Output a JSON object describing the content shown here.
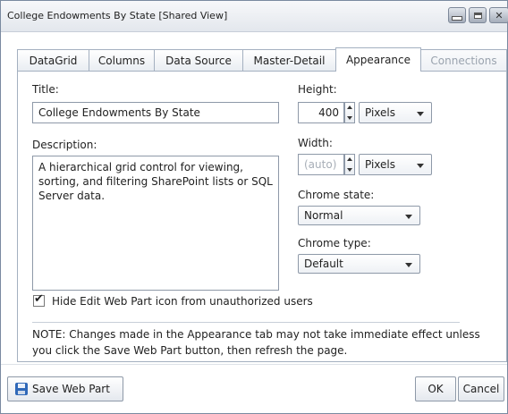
{
  "window": {
    "title": "College Endowments By State [Shared View]"
  },
  "tabs": [
    {
      "label": "DataGrid",
      "state": "normal"
    },
    {
      "label": "Columns",
      "state": "normal"
    },
    {
      "label": "Data Source",
      "state": "normal"
    },
    {
      "label": "Master-Detail",
      "state": "normal"
    },
    {
      "label": "Appearance",
      "state": "active"
    },
    {
      "label": "Connections",
      "state": "disabled"
    }
  ],
  "form": {
    "title_label": "Title:",
    "title_value": "College Endowments By State",
    "description_label": "Description:",
    "description_value": "A hierarchical grid control for viewing, sorting, and filtering SharePoint lists or SQL Server data.",
    "height_label": "Height:",
    "height_value": "400",
    "height_unit": "Pixels",
    "width_label": "Width:",
    "width_value": "(auto)",
    "width_unit": "Pixels",
    "chrome_state_label": "Chrome state:",
    "chrome_state_value": "Normal",
    "chrome_type_label": "Chrome type:",
    "chrome_type_value": "Default",
    "hide_icon_label": "Hide Edit Web Part icon from unauthorized users",
    "hide_icon_checked": true,
    "note": "NOTE: Changes made in the Appearance tab may not take immediate effect unless you click the Save Web Part button, then refresh the page."
  },
  "footer": {
    "save_label": "Save Web Part",
    "ok_label": "OK",
    "cancel_label": "Cancel"
  },
  "icons": {
    "minimize": "minimize-icon",
    "maximize": "maximize-icon",
    "close": "close-icon",
    "save": "floppy-disk-icon"
  },
  "colors": {
    "border": "#a4b0c0",
    "save_icon": "#2f68b8"
  }
}
